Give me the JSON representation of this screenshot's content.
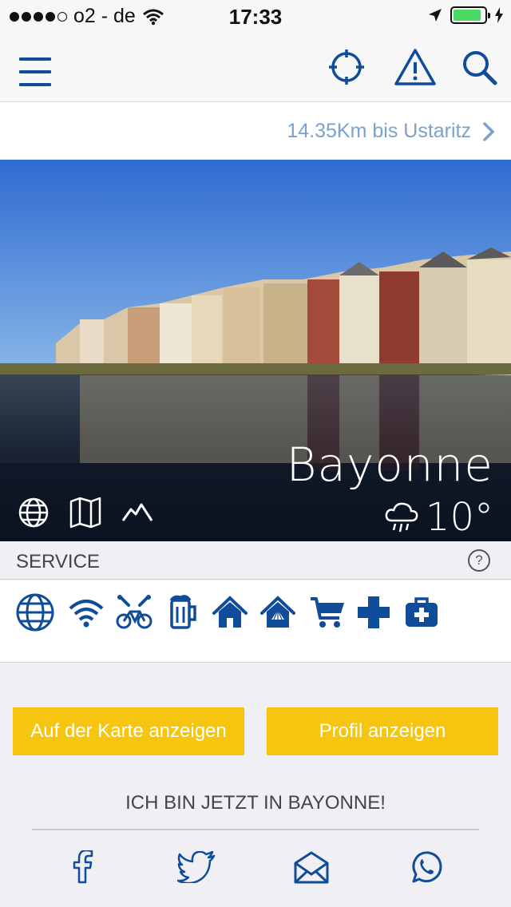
{
  "status_bar": {
    "carrier": "o2 - de",
    "time": "17:33",
    "battery_level": 0.9
  },
  "navbar": {
    "menu_icon": "hamburger-menu-icon",
    "actions": [
      "crosshair-locate-icon",
      "warning-icon",
      "search-icon"
    ]
  },
  "route": {
    "distance_text": "14.35Km bis Ustaritz"
  },
  "hero": {
    "city": "Bayonne",
    "temperature": "10°",
    "weather_icon": "cloud-rain-icon",
    "icons": [
      "globe-icon",
      "map-icon",
      "mountain-profile-icon"
    ]
  },
  "service": {
    "title": "SERVICE",
    "help_label": "?",
    "icons": [
      "globe-icon",
      "wifi-icon",
      "bike-repair-icon",
      "beer-icon",
      "house-icon",
      "pilgrim-hostel-icon",
      "cart-icon",
      "pharmacy-cross-icon",
      "first-aid-kit-icon"
    ]
  },
  "buttons": {
    "map_label": "Auf der Karte anzeigen",
    "profile_label": "Profil anzeigen"
  },
  "share": {
    "headline": "ICH BIN JETZT IN  BAYONNE!",
    "icons": [
      "facebook-icon",
      "twitter-icon",
      "email-icon",
      "whatsapp-icon"
    ]
  },
  "colors": {
    "accent_blue": "#0f4d9a",
    "button_yellow": "#f5c50f",
    "distance_text": "#7aa2cc"
  }
}
